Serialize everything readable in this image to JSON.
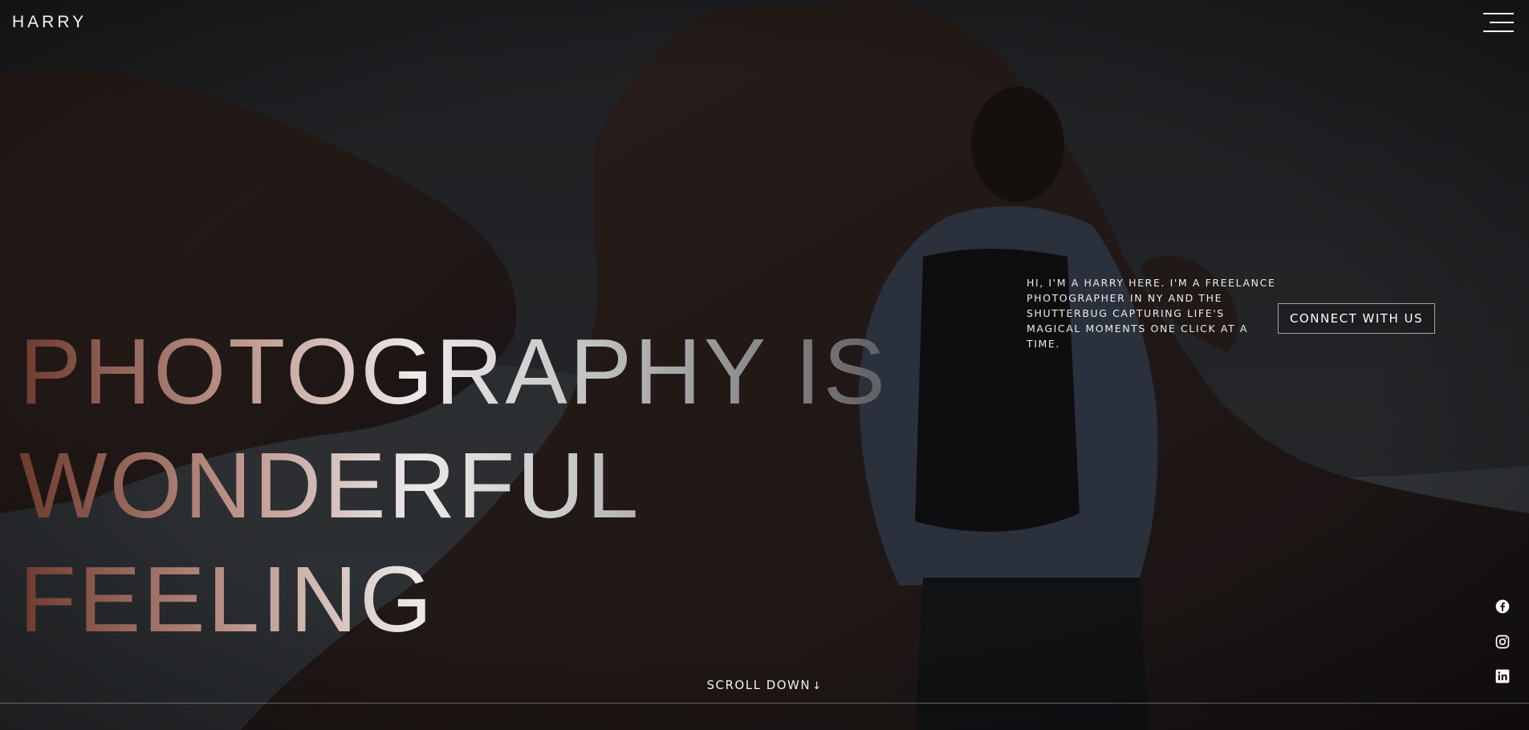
{
  "brand": {
    "logo_text": "HARRY"
  },
  "nav": {
    "menu_icon": "hamburger-menu-icon"
  },
  "hero": {
    "headline_line1": "PHOTOGRAPHY IS",
    "headline_line2": "WONDERFUL",
    "headline_line3": "FEELING",
    "intro_text": "HI, I'M A HARRY HERE. I'M A FREELANCE PHOTOGRAPHER IN NY AND THE SHUTTERBUG CAPTURING LIFE'S MAGICAL MOMENTS ONE CLICK AT A TIME.",
    "cta_label": "CONNECT WITH US",
    "gradient_colors": [
      "#6e3a2e",
      "#b58a7f",
      "#ece9e8",
      "#c9c9c9",
      "#5a5a5e"
    ]
  },
  "social": [
    {
      "icon": "facebook-icon"
    },
    {
      "icon": "instagram-icon"
    },
    {
      "icon": "linkedin-icon"
    }
  ],
  "scroll": {
    "label": "SCROLL DOWN",
    "arrow": "↓"
  }
}
